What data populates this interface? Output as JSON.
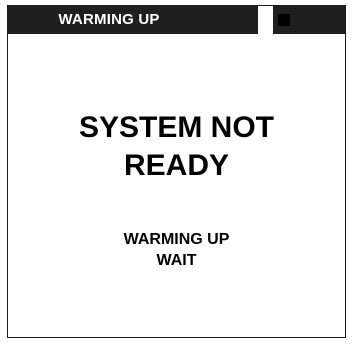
{
  "header": {
    "title": "WARMING UP"
  },
  "message": {
    "line1": "SYSTEM NOT",
    "line2": "READY"
  },
  "sub_message": {
    "line1": "WARMING UP",
    "line2": "WAIT"
  },
  "colors": {
    "header_bg": "#1f1f1f",
    "text": "#000000",
    "background": "#ffffff"
  }
}
